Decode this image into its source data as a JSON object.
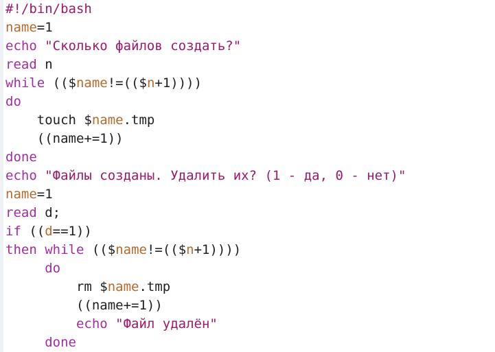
{
  "colors": {
    "keyword": "#a12ea1",
    "string": "#9a1a6b",
    "variable": "#b56a2d",
    "plain": "#1e1e1e",
    "background": "#ffffff"
  },
  "lines": [
    [
      {
        "t": "#!/bin/bash",
        "c": "shebang"
      }
    ],
    [
      {
        "t": "name",
        "c": "var"
      },
      {
        "t": "=1",
        "c": "plain"
      }
    ],
    [
      {
        "t": "echo ",
        "c": "kw"
      },
      {
        "t": "\"Сколько файлов создать?\"",
        "c": "str"
      }
    ],
    [
      {
        "t": "read",
        "c": "kw"
      },
      {
        "t": " n",
        "c": "plain"
      }
    ],
    [
      {
        "t": "while",
        "c": "kw"
      },
      {
        "t": " (($",
        "c": "plain"
      },
      {
        "t": "name",
        "c": "var"
      },
      {
        "t": "!=(($",
        "c": "plain"
      },
      {
        "t": "n",
        "c": "var"
      },
      {
        "t": "+1))))",
        "c": "plain"
      }
    ],
    [
      {
        "t": "do",
        "c": "kw"
      }
    ],
    [
      {
        "t": "    touch $",
        "c": "plain"
      },
      {
        "t": "name",
        "c": "var"
      },
      {
        "t": ".tmp",
        "c": "plain"
      }
    ],
    [
      {
        "t": "    ((name+=1))",
        "c": "plain"
      }
    ],
    [
      {
        "t": "done",
        "c": "kw"
      }
    ],
    [
      {
        "t": "echo ",
        "c": "kw"
      },
      {
        "t": "\"Файлы созданы. Удалить их? (1 - да, 0 - нет)\"",
        "c": "str"
      }
    ],
    [
      {
        "t": "name",
        "c": "var"
      },
      {
        "t": "=1",
        "c": "plain"
      }
    ],
    [
      {
        "t": "read",
        "c": "kw"
      },
      {
        "t": " d;",
        "c": "plain"
      }
    ],
    [
      {
        "t": "if",
        "c": "kw"
      },
      {
        "t": " ((",
        "c": "plain"
      },
      {
        "t": "d",
        "c": "var"
      },
      {
        "t": "==1))",
        "c": "plain"
      }
    ],
    [
      {
        "t": "then",
        "c": "kw"
      },
      {
        "t": " ",
        "c": "plain"
      },
      {
        "t": "while",
        "c": "kw"
      },
      {
        "t": " (($",
        "c": "plain"
      },
      {
        "t": "name",
        "c": "var"
      },
      {
        "t": "!=(($",
        "c": "plain"
      },
      {
        "t": "n",
        "c": "var"
      },
      {
        "t": "+1))))",
        "c": "plain"
      }
    ],
    [
      {
        "t": "     ",
        "c": "plain"
      },
      {
        "t": "do",
        "c": "kw"
      }
    ],
    [
      {
        "t": "         rm $",
        "c": "plain"
      },
      {
        "t": "name",
        "c": "var"
      },
      {
        "t": ".tmp",
        "c": "plain"
      }
    ],
    [
      {
        "t": "         ((name+=1))",
        "c": "plain"
      }
    ],
    [
      {
        "t": "         ",
        "c": "plain"
      },
      {
        "t": "echo ",
        "c": "kw"
      },
      {
        "t": "\"Файл удалён\"",
        "c": "str"
      }
    ],
    [
      {
        "t": "     ",
        "c": "plain"
      },
      {
        "t": "done",
        "c": "kw"
      }
    ]
  ]
}
